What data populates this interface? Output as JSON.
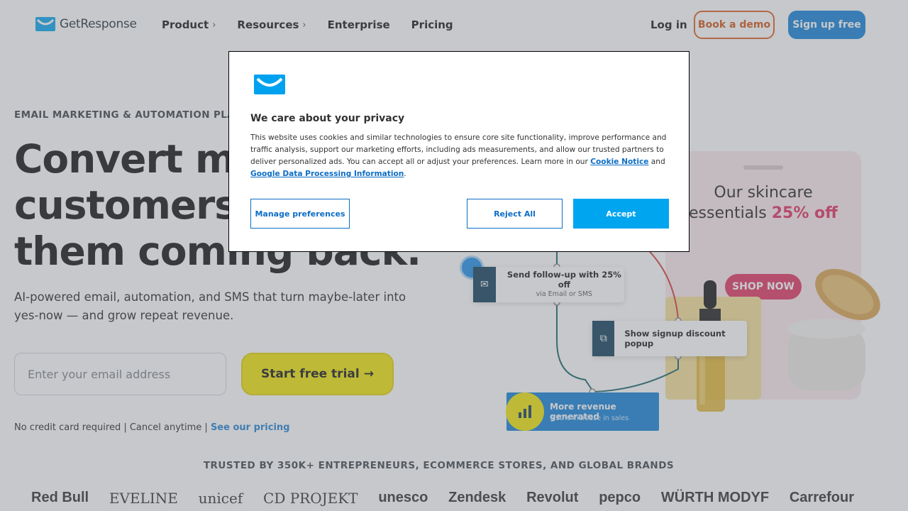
{
  "header": {
    "logo_text": "GetResponse",
    "nav": [
      {
        "label": "Product",
        "has_chevron": true
      },
      {
        "label": "Resources",
        "has_chevron": true
      },
      {
        "label": "Enterprise",
        "has_chevron": false
      },
      {
        "label": "Pricing",
        "has_chevron": false
      }
    ],
    "login": "Log in",
    "book_demo": "Book a demo",
    "sign_up": "Sign up free"
  },
  "hero": {
    "eyebrow": "EMAIL MARKETING & AUTOMATION PLATFORM",
    "headline": "Convert more customers. Keep them coming back.",
    "subheading": "AI-powered email, automation, and SMS that turn maybe-later into yes-now — and grow repeat revenue.",
    "email_placeholder": "Enter your email address",
    "cta": "Start free trial",
    "fine_print": "No credit card required | Cancel anytime | ",
    "pricing_link": "See our pricing"
  },
  "illustration": {
    "skincare_line1": "Our skincare",
    "skincare_line2": "essentials",
    "skincare_off": "25% off",
    "shop_now": "SHOP NOW",
    "followup_title": "Send follow-up with 25% off",
    "followup_sub": "via Email or SMS",
    "popup_title": "Show signup discount popup",
    "revenue_title": "More revenue generated",
    "revenue_sub": "+30% increase in sales"
  },
  "trusted": {
    "label": "TRUSTED BY 350K+ ENTREPRENEURS, ECOMMERCE STORES, AND GLOBAL BRANDS",
    "brands": [
      "Red Bull",
      "EVELINE",
      "unicef",
      "CD PROJEKT",
      "unesco",
      "Zendesk",
      "Revolut",
      "pepco",
      "WÜRTH MODYF",
      "Carrefour"
    ]
  },
  "cookie_modal": {
    "title": "We care about your privacy",
    "body": "This website uses cookies and similar technologies to ensure core site functionality, improve performance and traffic analysis, support our marketing efforts, including ads measurements, and allow our trusted partners to deliver personalized ads. You can accept all or adjust your preferences. Learn more in our ",
    "cookie_link": "Cookie Notice",
    "and": " and ",
    "gdpr_link": "Google Data Processing Information",
    "period": ".",
    "manage": "Manage preferences",
    "reject": "Reject All",
    "accept": "Accept"
  },
  "colors": {
    "brand_blue": "#0d7fd8",
    "cta_yellow": "#f2e500",
    "demo_orange": "#e05a1c",
    "accept_blue": "#00a5f0",
    "sale_pink": "#e0305f"
  }
}
